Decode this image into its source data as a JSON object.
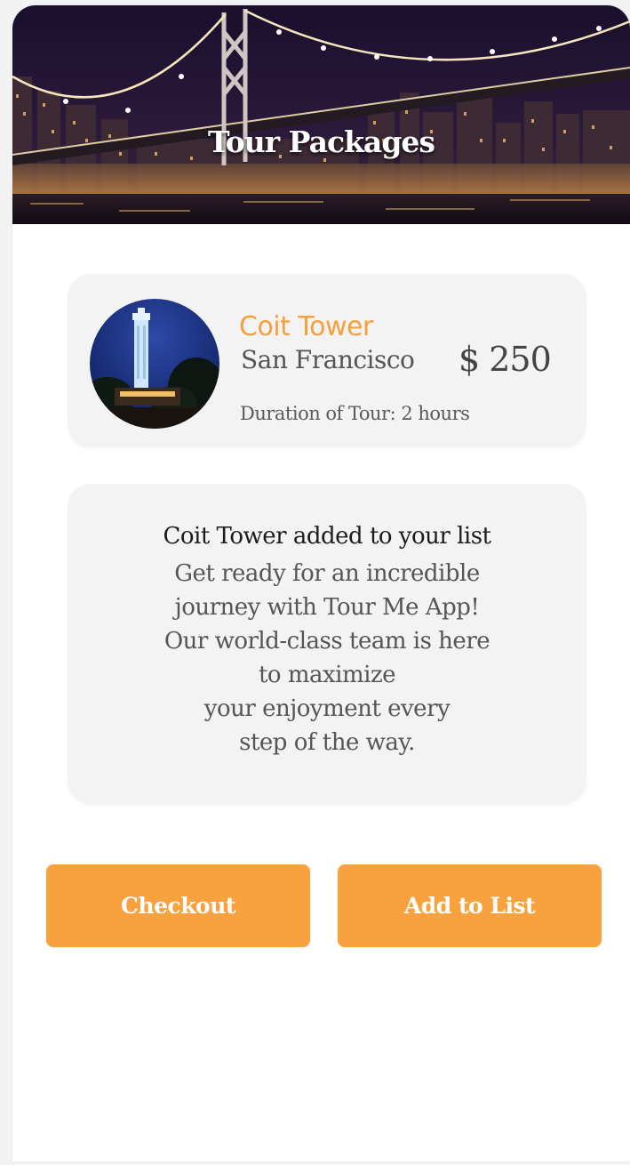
{
  "header": {
    "title": "Tour Packages",
    "background_image": "city-bridge-night-image"
  },
  "tour": {
    "name": "Coit Tower",
    "city": "San Francisco",
    "price": "$ 250",
    "duration": "Duration of Tour: 2 hours",
    "image": "coit-tower-night-image"
  },
  "message": {
    "title": "Coit Tower added to your list",
    "body_lines": [
      "Get ready for an incredible",
      "journey with Tour Me App!",
      "Our world-class team is here",
      "to maximize",
      "your enjoyment every",
      "step of the way."
    ]
  },
  "buttons": {
    "checkout_label": "Checkout",
    "add_label": "Add to List"
  },
  "colors": {
    "accent": "#f7a23e",
    "tour_name": "#f5a03c",
    "card_bg": "#f3f3f3"
  }
}
